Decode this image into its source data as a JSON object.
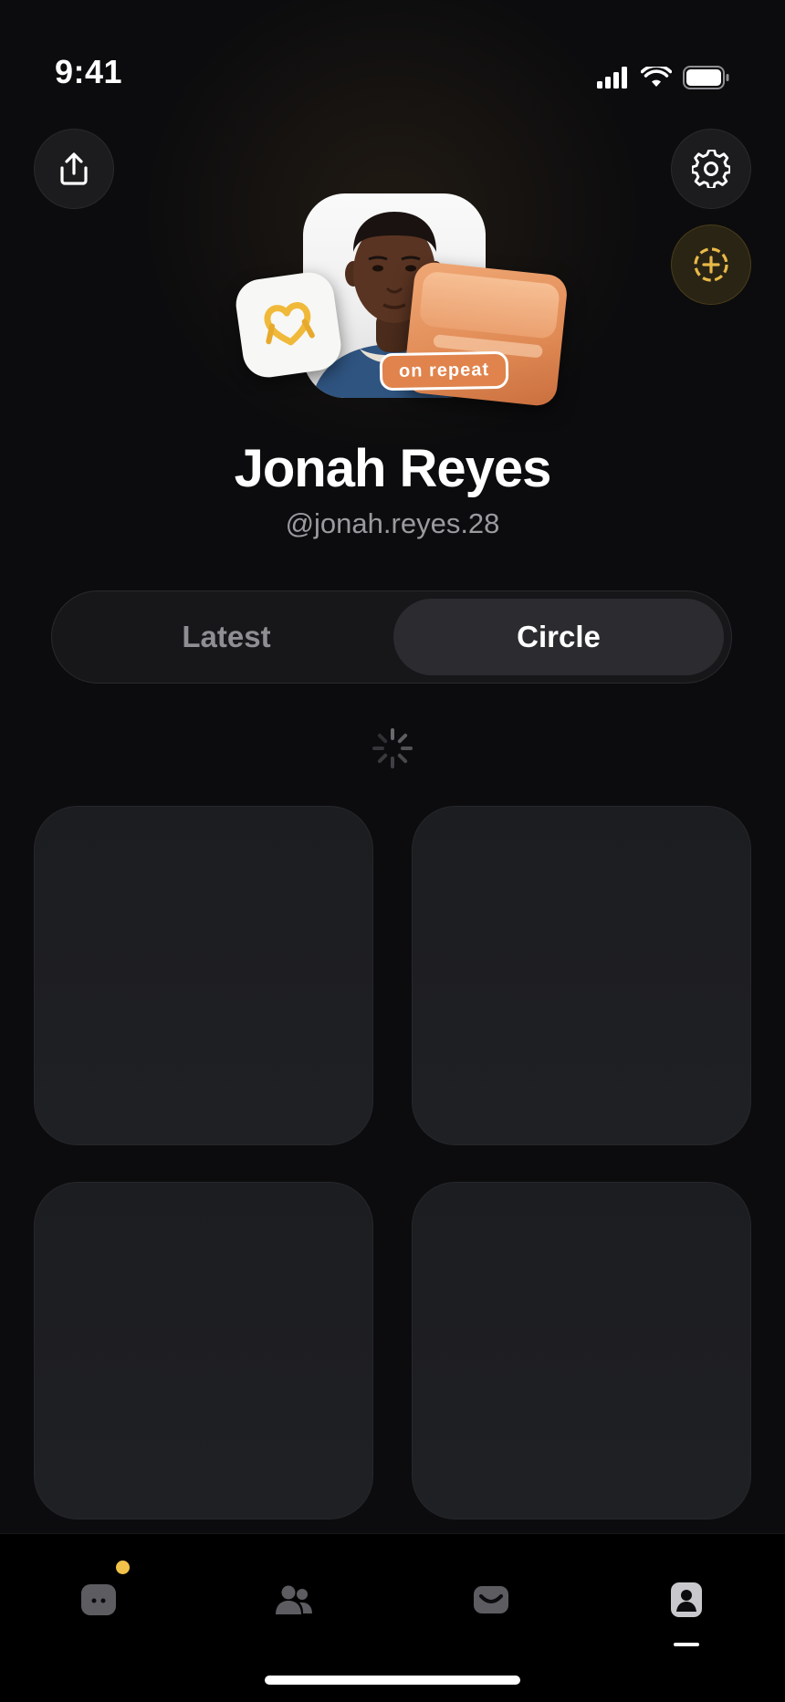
{
  "status_bar": {
    "time": "9:41"
  },
  "profile": {
    "display_name": "Jonah Reyes",
    "handle": "@jonah.reyes.28",
    "sticker_label": "on repeat"
  },
  "segmented_control": {
    "tabs": [
      {
        "label": "Latest",
        "selected": false
      },
      {
        "label": "Circle",
        "selected": true
      }
    ]
  },
  "header_actions": {
    "share_icon": "share-icon",
    "settings_icon": "gear-icon",
    "add_icon": "add-circle-dashed-icon"
  },
  "tab_bar": {
    "items": [
      {
        "icon": "home-face-icon",
        "has_notification": true
      },
      {
        "icon": "friends-icon"
      },
      {
        "icon": "inbox-icon"
      },
      {
        "icon": "profile-icon",
        "active": true
      }
    ]
  },
  "colors": {
    "background": "#0c0c0e",
    "accent": "#f2c149",
    "sticker_orange": "#e0834c",
    "segment_selected": "#2c2c30",
    "tile": "#1d1e21"
  }
}
